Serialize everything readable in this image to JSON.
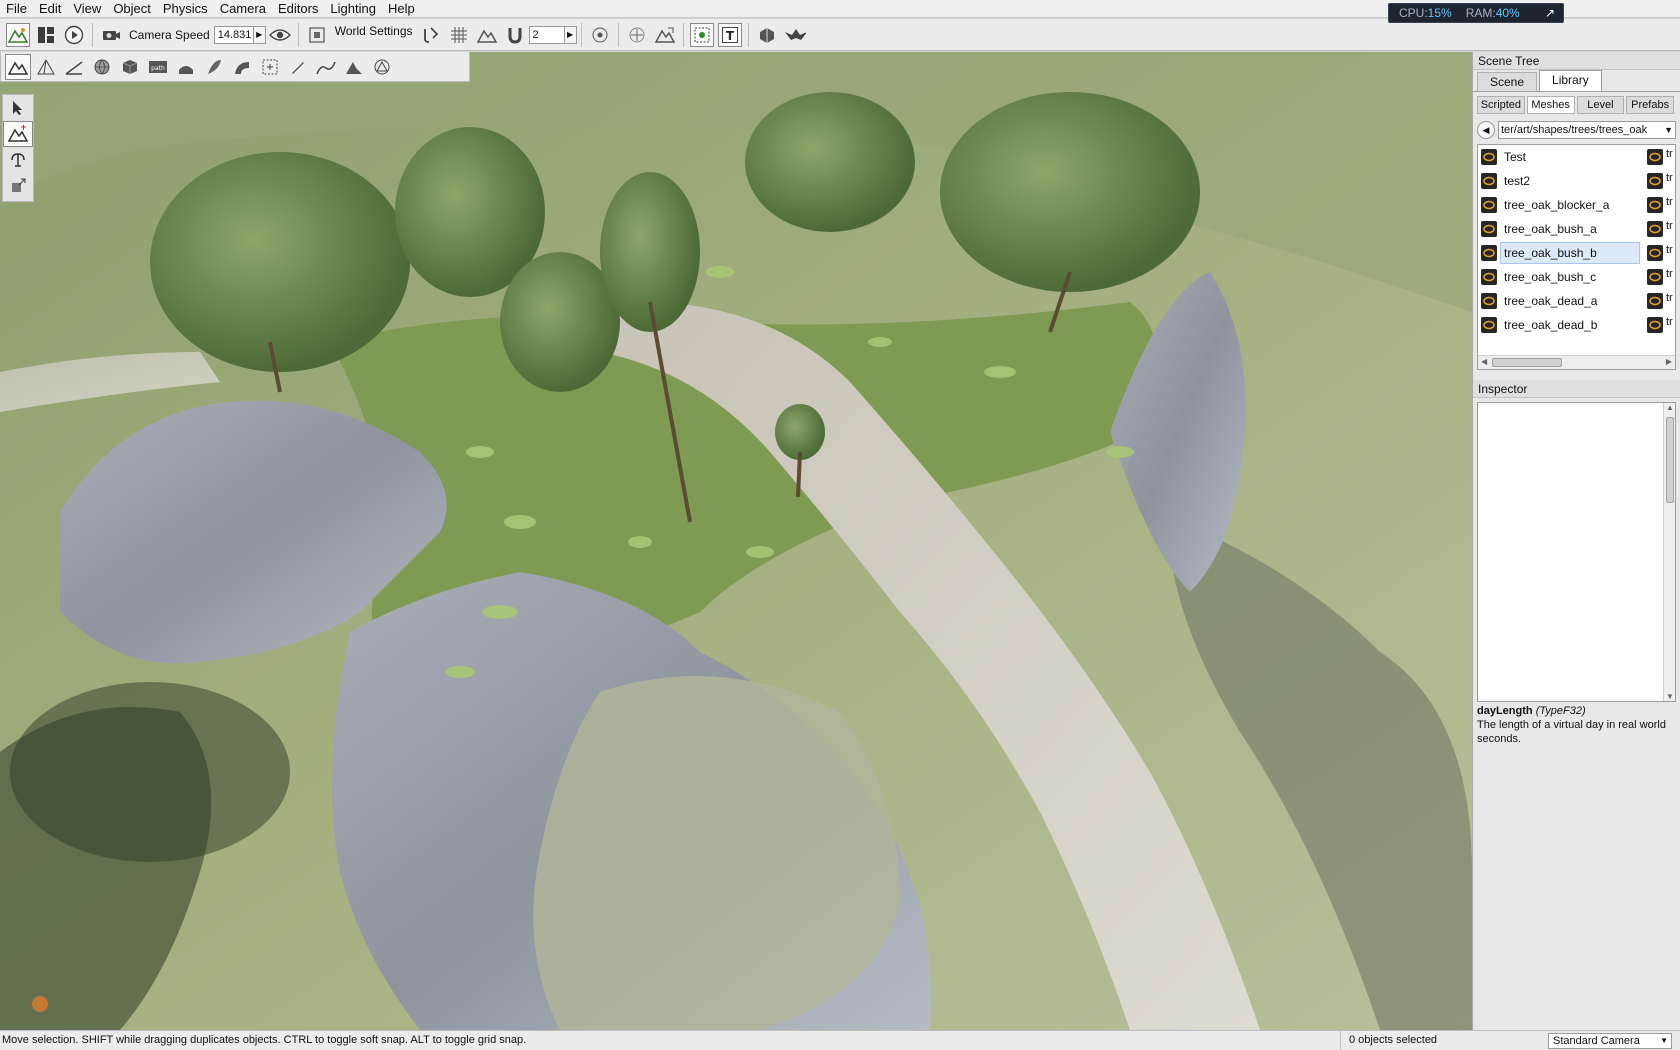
{
  "menu": [
    "File",
    "Edit",
    "View",
    "Object",
    "Physics",
    "Camera",
    "Editors",
    "Lighting",
    "Help"
  ],
  "perf": {
    "cpu_label": "CPU:",
    "cpu_value": "15%",
    "ram_label": "RAM:",
    "ram_value": "40%"
  },
  "toolbar": {
    "camera_speed_label": "Camera Speed",
    "camera_speed_value": "14.831",
    "world_settings_label": "World Settings",
    "grid_value": "2"
  },
  "scene_tree": {
    "title": "Scene Tree",
    "tabs": [
      "Scene",
      "Library"
    ],
    "subtabs": [
      "Scripted",
      "Meshes",
      "Level",
      "Prefabs"
    ],
    "path": "ter/art/shapes/trees/trees_oak",
    "items": [
      "Test",
      "test2",
      "tree_oak_blocker_a",
      "tree_oak_bush_a",
      "tree_oak_bush_b",
      "tree_oak_bush_c",
      "tree_oak_dead_a",
      "tree_oak_dead_b"
    ],
    "clipped_col_text": "tr"
  },
  "inspector": {
    "title": "Inspector",
    "field_name": "dayLength",
    "field_type": "(TypeF32)",
    "field_desc": "The length of a virtual day in real world seconds."
  },
  "status": {
    "message": "Move selection.  SHIFT while dragging duplicates objects.  CTRL to toggle soft snap.  ALT to toggle grid snap.",
    "selection": "0 objects selected",
    "camera": "Standard Camera"
  },
  "colors": {
    "accent": "#5fc4ff",
    "selection": "#dce9f8",
    "panel": "#e8e8e8"
  }
}
